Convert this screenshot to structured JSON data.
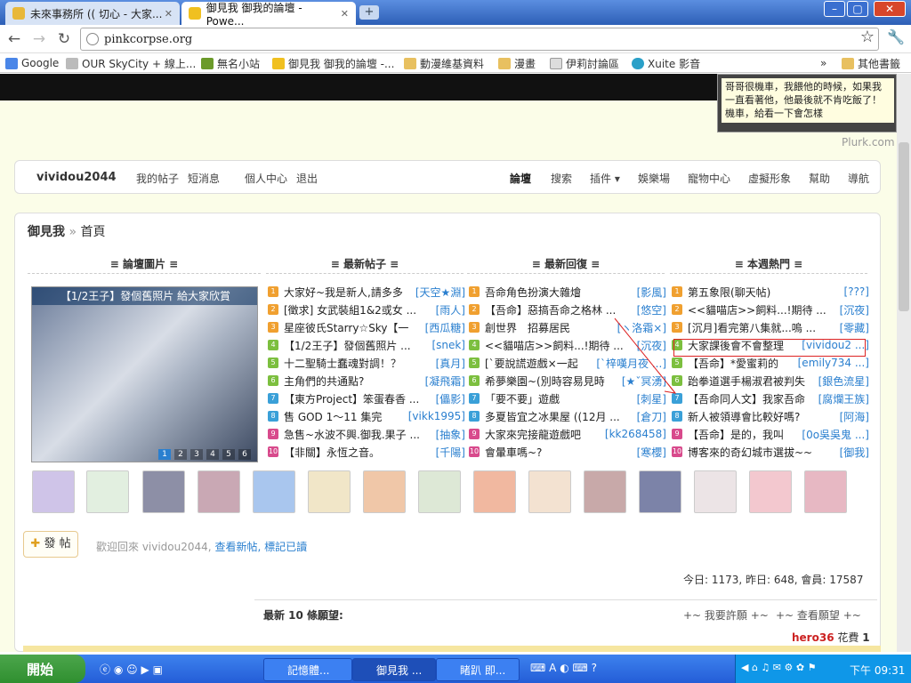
{
  "browser": {
    "tabs": [
      {
        "title": "未來事務所 (( 切心 - 大家..."
      },
      {
        "title": "御見我 御我的論壇 - Powe..."
      }
    ],
    "url": "pinkcorpse.org",
    "bookmarks": [
      {
        "label": "Google",
        "icon": "google-icon"
      },
      {
        "label": "OUR SkyCity + 線上...",
        "icon": "page-icon"
      },
      {
        "label": "無名小站",
        "icon": "wretch-icon"
      },
      {
        "label": "御見我 御我的論壇 -...",
        "icon": "forum-icon"
      },
      {
        "label": "動漫維基資料",
        "icon": "folder-icon"
      },
      {
        "label": "漫畫",
        "icon": "folder-icon"
      },
      {
        "label": "伊莉討論區",
        "icon": "page-icon"
      },
      {
        "label": "Xuite 影音",
        "icon": "xuite-icon"
      }
    ],
    "bookmarks_more": "»",
    "other_bookmarks": "其他書籤"
  },
  "plurk": {
    "text": "哥哥很機車，我餵他的時候，如果我一直看著他，他最後就不肯吃飯了！機車，給看一下會怎樣",
    "label": "Plurk.com"
  },
  "userbar": {
    "username": "vividou2044",
    "links_left": [
      "我的帖子",
      "短消息",
      "個人中心",
      "退出"
    ],
    "nav": [
      "論壇",
      "搜索",
      "插件 ▾",
      "娛樂場",
      "寵物中心",
      "虛擬形象",
      "幫助",
      "導航"
    ]
  },
  "breadcrumb": {
    "home": "御見我",
    "sep": "»",
    "current": "首頁"
  },
  "columns": {
    "images": "≡ 論壇圖片 ≡",
    "latest_posts": "≡ 最新帖子 ≡",
    "latest_replies": "≡ 最新回復 ≡",
    "hot_week": "≡ 本週熱門 ≡"
  },
  "photo": {
    "caption": "【1/2王子】發個舊照片 給大家欣賞",
    "pages": [
      "1",
      "2",
      "3",
      "4",
      "5",
      "6"
    ]
  },
  "latest_posts": [
    {
      "n": "1",
      "title": "大家好~我是新人,請多多",
      "author": "[天空★淵]",
      "c": "#f0a030"
    },
    {
      "n": "2",
      "title": "[徵求] 女武裝組1&2或女 ...",
      "author": "[雨人]",
      "c": "#f0a030"
    },
    {
      "n": "3",
      "title": "星座彼氏Starry☆Sky【一",
      "author": "[西瓜糖]",
      "c": "#f0a030"
    },
    {
      "n": "4",
      "title": "【1/2王子】發個舊照片 ...",
      "author": "[snek]",
      "c": "#7cbf3f"
    },
    {
      "n": "5",
      "title": "十二聖騎士蠢魂對調！？",
      "author": "[真月]",
      "c": "#7cbf3f"
    },
    {
      "n": "6",
      "title": "主角們的共通點?",
      "author": "[凝飛霜]",
      "c": "#7cbf3f"
    },
    {
      "n": "7",
      "title": "【東方Project】笨蛋春香 ...",
      "author": "[儡影]",
      "c": "#3aa0d8"
    },
    {
      "n": "8",
      "title": "售 GOD 1～11 集完",
      "author": "[vikk1995]",
      "c": "#3aa0d8"
    },
    {
      "n": "9",
      "title": "急售~水波不興.御我.果子 ...",
      "author": "[抽象]",
      "c": "#d84a8c"
    },
    {
      "n": "10",
      "title": "【非關】永恆之音。",
      "author": "[千陽]",
      "c": "#d84a8c"
    }
  ],
  "latest_replies": [
    {
      "n": "1",
      "title": "吾命角色扮演大雜燴",
      "author": "[影風]",
      "c": "#f0a030"
    },
    {
      "n": "2",
      "title": "【吾命】惡搞吾命之格林 ...",
      "author": "[悠空]",
      "c": "#f0a030"
    },
    {
      "n": "3",
      "title": "創世界　招募居民",
      "author": "[ヽ洛霜×]",
      "c": "#f0a030"
    },
    {
      "n": "4",
      "title": "<<貓喵店>>飼料...!期待 ...",
      "author": "[沉夜]",
      "c": "#7cbf3f"
    },
    {
      "n": "5",
      "title": "[`要說謊遊戲×一起",
      "author": "[`梓嘆月夜 ...]",
      "c": "#7cbf3f"
    },
    {
      "n": "6",
      "title": "希夢樂園~(別時容易見時",
      "author": "[★ˇ冥湧]",
      "c": "#7cbf3f"
    },
    {
      "n": "7",
      "title": "「要不要」遊戲",
      "author": "[刺星]",
      "c": "#3aa0d8"
    },
    {
      "n": "8",
      "title": "多夏皆宜之冰果屋 ((12月 ...",
      "author": "[倉刀]",
      "c": "#3aa0d8"
    },
    {
      "n": "9",
      "title": "大家來完接龍遊戲吧",
      "author": "[kk268458]",
      "c": "#d84a8c"
    },
    {
      "n": "10",
      "title": "會暈車嗎~?",
      "author": "[寒櫻]",
      "c": "#d84a8c"
    }
  ],
  "hot_week": [
    {
      "n": "1",
      "title": "第五象限(聊天帖)",
      "author": "[???]",
      "c": "#f0a030"
    },
    {
      "n": "2",
      "title": "<<貓喵店>>飼料...!期待 ...",
      "author": "[沉夜]",
      "c": "#f0a030"
    },
    {
      "n": "3",
      "title": "[沉月]看完第八集就...嗚 ...",
      "author": "[零藏]",
      "c": "#f0a030"
    },
    {
      "n": "4",
      "title": "大家課後會不會整理",
      "author": "[vividou2 ...]",
      "c": "#7cbf3f"
    },
    {
      "n": "5",
      "title": "【吾命】*愛蜜莉的",
      "author": "[emily734 ...]",
      "c": "#7cbf3f"
    },
    {
      "n": "6",
      "title": "跆拳道選手楊淑君被判失",
      "author": "[銀色流星]",
      "c": "#7cbf3f"
    },
    {
      "n": "7",
      "title": "【吾命同人文】我家吾命",
      "author": "[腐爛王族]",
      "c": "#3aa0d8"
    },
    {
      "n": "8",
      "title": "新人被領導會比較好嗎?",
      "author": "[阿海]",
      "c": "#3aa0d8"
    },
    {
      "n": "9",
      "title": "【吾命】是的，我叫",
      "author": "[0o吳吳鬼 ...]",
      "c": "#d84a8c"
    },
    {
      "n": "10",
      "title": "博客來的奇幻城市選拔~~",
      "author": "[御我]",
      "c": "#d84a8c"
    }
  ],
  "post_button": "發 帖",
  "welcome": {
    "prefix": "歡迎回來 vividou2044,",
    "link1": "查看新帖,",
    "link2": "標記已讀"
  },
  "stats": "今日: 1173, 昨日: 648, 會員: 17587",
  "wishes": {
    "title": "最新 10 條願望:",
    "link1": "+~ 我要許願 +~",
    "link2": "+~ 查看願望 +~",
    "user": "hero36",
    "action": "花費",
    "amount": "1"
  },
  "taskbar": {
    "start": "開始",
    "tasks": [
      "記憶體...",
      "御見我 ...",
      "睹趴 即..."
    ],
    "clock": "下午 09:31"
  }
}
